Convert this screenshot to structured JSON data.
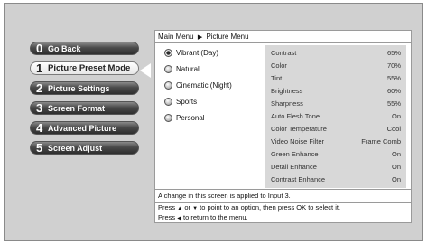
{
  "menu": {
    "items": [
      {
        "num": "0",
        "label": "Go Back"
      },
      {
        "num": "1",
        "label": "Picture Preset Mode"
      },
      {
        "num": "2",
        "label": "Picture Settings"
      },
      {
        "num": "3",
        "label": "Screen Format"
      },
      {
        "num": "4",
        "label": "Advanced Picture"
      },
      {
        "num": "5",
        "label": "Screen Adjust"
      }
    ],
    "active_index": 1
  },
  "breadcrumb": {
    "root": "Main Menu",
    "separator": "▶",
    "current": "Picture Menu"
  },
  "presets": {
    "items": [
      "Vibrant (Day)",
      "Natural",
      "Cinematic (Night)",
      "Sports",
      "Personal"
    ],
    "selected": "Vibrant (Day)"
  },
  "settings": [
    {
      "name": "Contrast",
      "value": "65%"
    },
    {
      "name": "Color",
      "value": "70%"
    },
    {
      "name": "Tint",
      "value": "55%"
    },
    {
      "name": "Brightness",
      "value": "60%"
    },
    {
      "name": "Sharpness",
      "value": "55%"
    },
    {
      "name": "Auto Flesh Tone",
      "value": "On"
    },
    {
      "name": "Color Temperature",
      "value": "Cool"
    },
    {
      "name": "Video Noise Filter",
      "value": "Frame Comb"
    },
    {
      "name": "Green Enhance",
      "value": "On"
    },
    {
      "name": "Detail Enhance",
      "value": "On"
    },
    {
      "name": "Contrast Enhance",
      "value": "On"
    }
  ],
  "note": "A change in this screen is applied to Input 3.",
  "help": {
    "line1_prefix": "Press",
    "up_glyph": "▲",
    "or": "or",
    "down_glyph": "▼",
    "line1_suffix": "to point to an option, then press OK to select it.",
    "line2_prefix": "Press",
    "left_glyph": "◀",
    "line2_suffix": "to return to the menu."
  },
  "colors": {
    "screen_bg": "#d0d0d0",
    "settings_bg": "#d8d8d8",
    "button_dark": "#3a3a3a"
  }
}
